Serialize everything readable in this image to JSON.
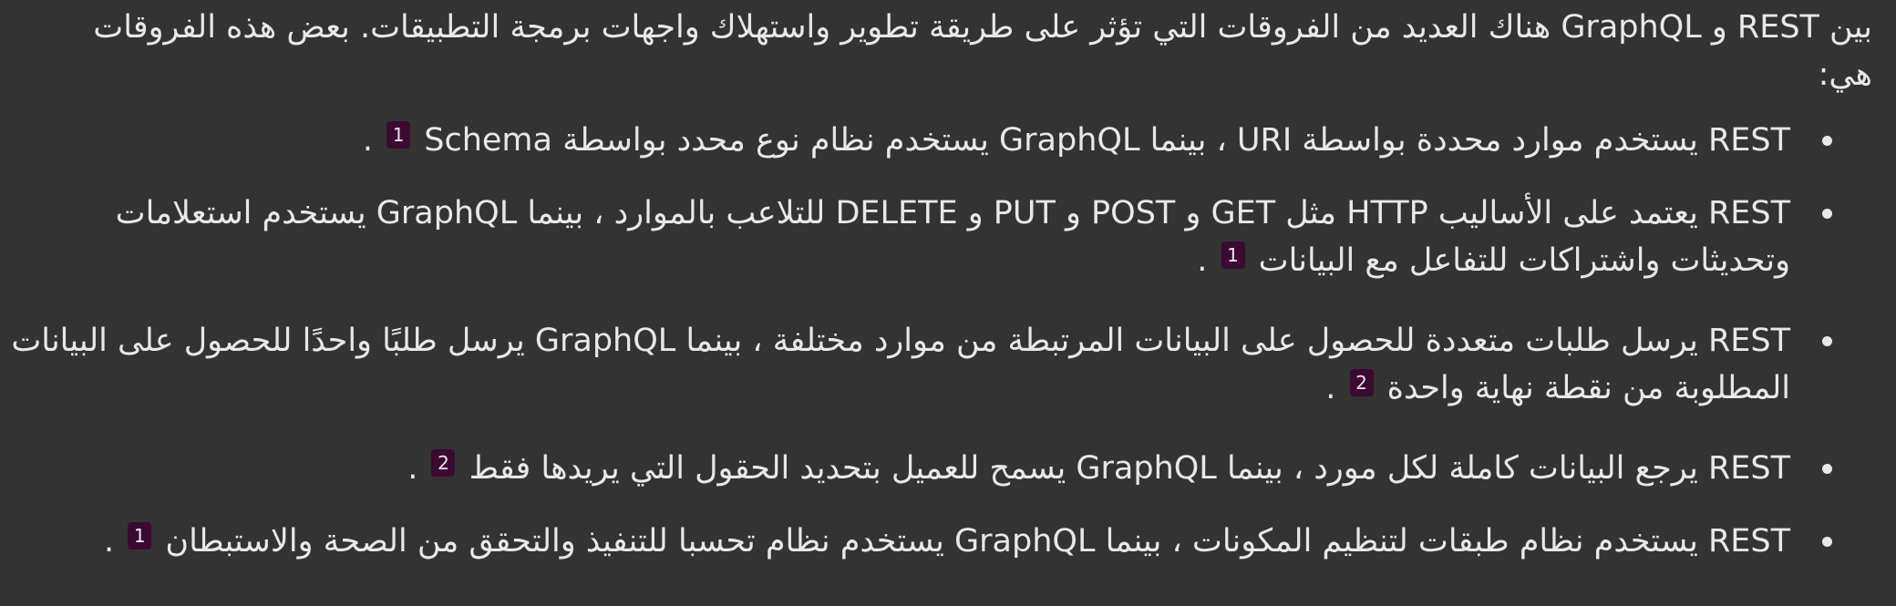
{
  "intro": "بين REST و GraphQL هناك العديد من الفروقات التي تؤثر على طريقة تطوير واستهلاك واجهات برمجة التطبيقات. بعض هذه الفروقات هي:",
  "items": [
    {
      "text": "REST يستخدم موارد محددة بواسطة URI ، بينما GraphQL يستخدم نظام نوع محدد بواسطة Schema",
      "cite": "1",
      "end": "."
    },
    {
      "text": "REST يعتمد على الأساليب HTTP مثل GET و POST و PUT و DELETE للتلاعب بالموارد ، بينما GraphQL يستخدم استعلامات وتحديثات واشتراكات للتفاعل مع البيانات",
      "cite": "1",
      "end": "."
    },
    {
      "text": "REST يرسل طلبات متعددة للحصول على البيانات المرتبطة من موارد مختلفة ، بينما GraphQL يرسل طلبًا واحدًا للحصول على البيانات المطلوبة من نقطة نهاية واحدة",
      "cite": "2",
      "end": "."
    },
    {
      "text": "REST يرجع البيانات كاملة لكل مورد ، بينما GraphQL يسمح للعميل بتحديد الحقول التي يريدها فقط",
      "cite": "2",
      "end": "."
    },
    {
      "text": "REST يستخدم نظام طبقات لتنظيم المكونات ، بينما GraphQL يستخدم نظام تحسبا للتنفيذ والتحقق من الصحة والاستبطان",
      "cite": "1",
      "end": "."
    }
  ],
  "colors": {
    "background": "#333333",
    "text": "#e8e8e8",
    "citation_badge": "#3a0a30"
  }
}
